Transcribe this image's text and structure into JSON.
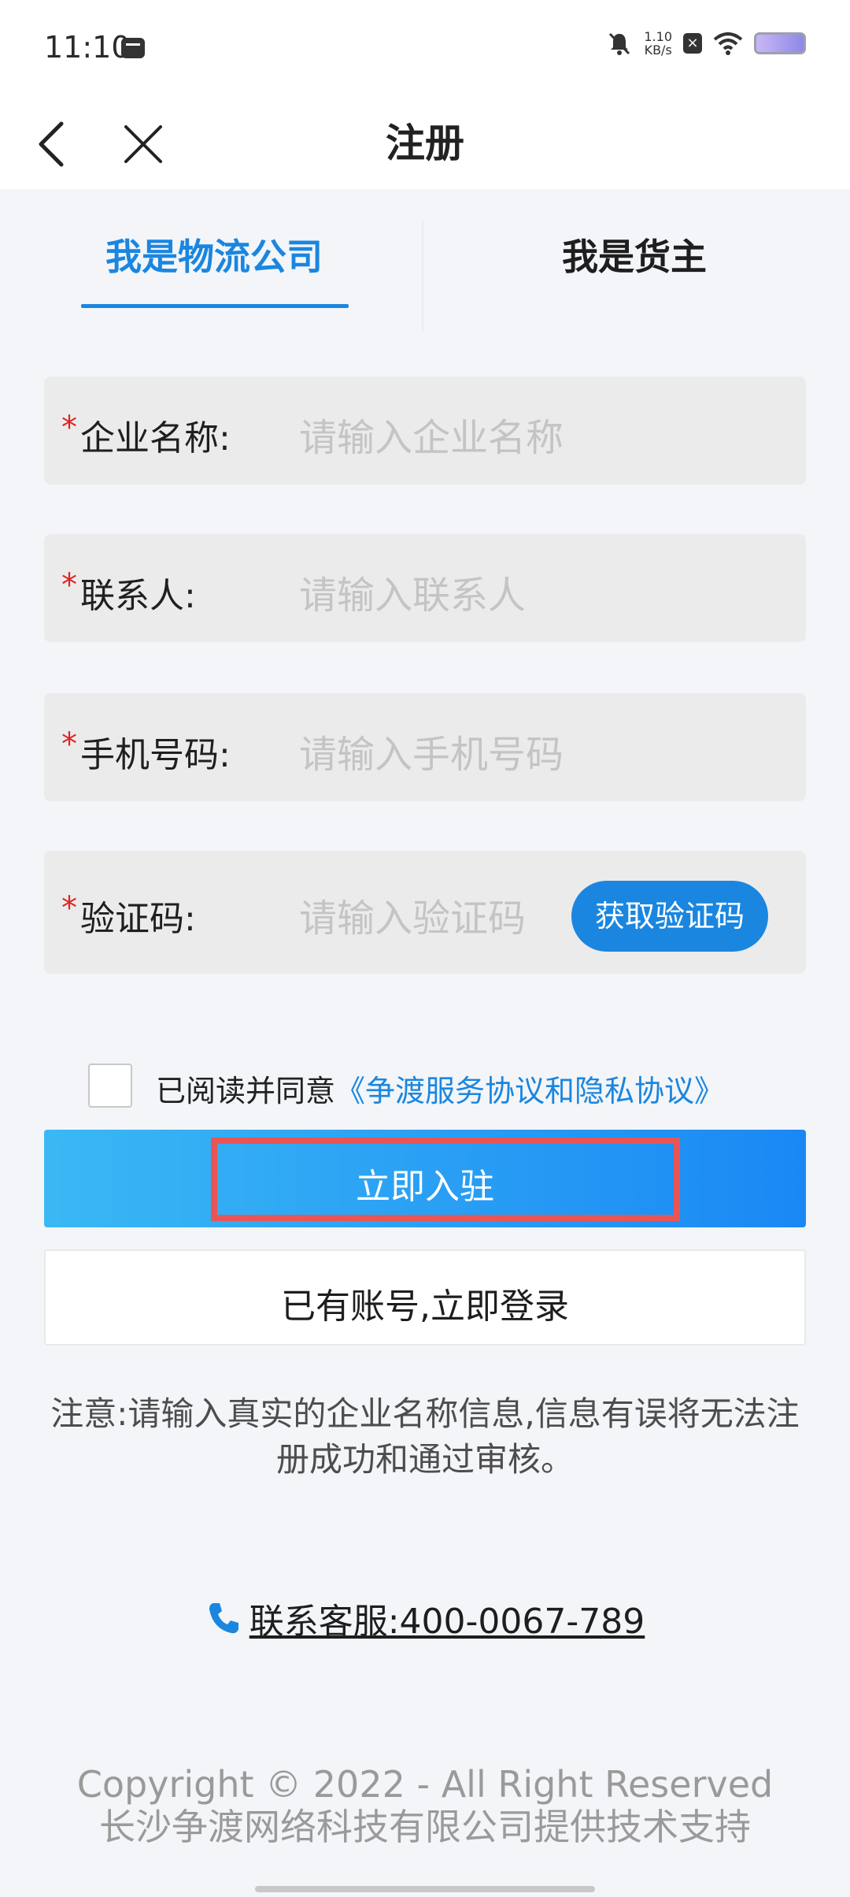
{
  "status_bar": {
    "time": "11:10",
    "net_speed": "1.10",
    "net_unit": "KB/s"
  },
  "nav": {
    "title": "注册"
  },
  "tabs": [
    {
      "label": "我是物流公司",
      "active": true
    },
    {
      "label": "我是货主",
      "active": false
    }
  ],
  "form": {
    "required_mark": "*",
    "company": {
      "label": "企业名称:",
      "placeholder": "请输入企业名称"
    },
    "contact": {
      "label": "联系人:",
      "placeholder": "请输入联系人"
    },
    "phone": {
      "label": "手机号码:",
      "placeholder": "请输入手机号码"
    },
    "code": {
      "label": "验证码:",
      "placeholder": "请输入验证码",
      "button": "获取验证码"
    }
  },
  "agreement": {
    "text": "已阅读并同意",
    "link": "《争渡服务协议和隐私协议》",
    "checked": false
  },
  "buttons": {
    "submit": "立即入驻",
    "login": "已有账号,立即登录"
  },
  "notice": "注意:请输入真实的企业名称信息,信息有误将无法注册成功和通过审核。",
  "service": "联系客服:400-0067-789",
  "footer": {
    "copyright": "Copyright © 2022 - All Right Reserved",
    "support": "长沙争渡网络科技有限公司提供技术支持"
  },
  "colors": {
    "accent": "#1a86e0",
    "required": "#e02424",
    "highlight_border": "#e85555"
  }
}
